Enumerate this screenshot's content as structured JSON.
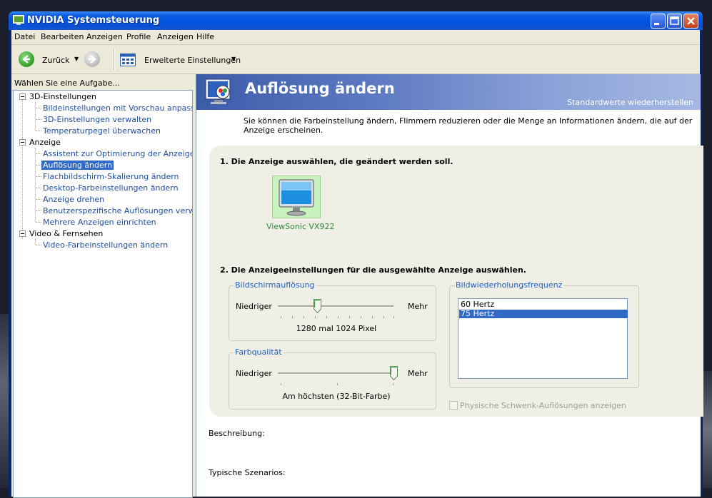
{
  "window": {
    "title": "NVIDIA Systemsteuerung"
  },
  "menu": [
    "Datei",
    "Bearbeiten",
    "Anzeigen",
    "Profile",
    "Anzeigen",
    "Hilfe"
  ],
  "toolbar": {
    "back_label": "Zurück",
    "advanced_label": "Erweiterte Einstellungen"
  },
  "tasks": {
    "label": "Wählen Sie eine Aufgabe...",
    "categories": [
      {
        "name": "3D-Einstellungen",
        "items": [
          "Bildeinstellungen mit Vorschau anpassen",
          "3D-Einstellungen verwalten",
          "Temperaturpegel überwachen"
        ]
      },
      {
        "name": "Anzeige",
        "items": [
          "Assistent zur Optimierung der Anzeige ausf",
          "Auflösung ändern",
          "Flachbildschirm-Skalierung ändern",
          "Desktop-Farbeinstellungen ändern",
          "Anzeige drehen",
          "Benutzerspezifische Auflösungen verwalten",
          "Mehrere Anzeigen einrichten"
        ]
      },
      {
        "name": "Video & Fernsehen",
        "items": [
          "Video-Farbeinstellungen ändern"
        ]
      }
    ],
    "selected": "Auflösung ändern"
  },
  "page": {
    "title": "Auflösung ändern",
    "restore_link": "Standardwerte wiederherstellen",
    "intro": "Sie können die Farbeinstellung ändern, Flimmern reduzieren oder die Menge an Informationen ändern, die auf der Anzeige erscheinen.",
    "step1": "1. Die Anzeige auswählen, die geändert werden soll.",
    "monitor_name": "ViewSonic VX922",
    "step2": "2. Die Anzeigeeinstellungen für die ausgewählte Anzeige auswählen.",
    "resolution": {
      "legend": "Bildschirmauflösung",
      "low": "Niedriger",
      "high": "Mehr",
      "value": "1280 mal 1024 Pixel",
      "level": 0.34
    },
    "color": {
      "legend": "Farbqualität",
      "low": "Niedriger",
      "high": "Mehr",
      "value": "Am höchsten (32-Bit-Farbe)",
      "level": 1.0
    },
    "refresh": {
      "legend": "Bildwiederholungsfrequenz",
      "options": [
        "60 Hertz",
        "75 Hertz"
      ],
      "selected": "75 Hertz"
    },
    "panning_checkbox": "Physische Schwenk-Auflösungen anzeigen",
    "description_label": "Beschreibung:",
    "scenarios_label": "Typische Szenarios:"
  },
  "colors": {
    "title_blue": "#0053e1",
    "selection": "#316ac5",
    "banner": "#5d79c2",
    "monitor_green": "#2e8a3a"
  }
}
